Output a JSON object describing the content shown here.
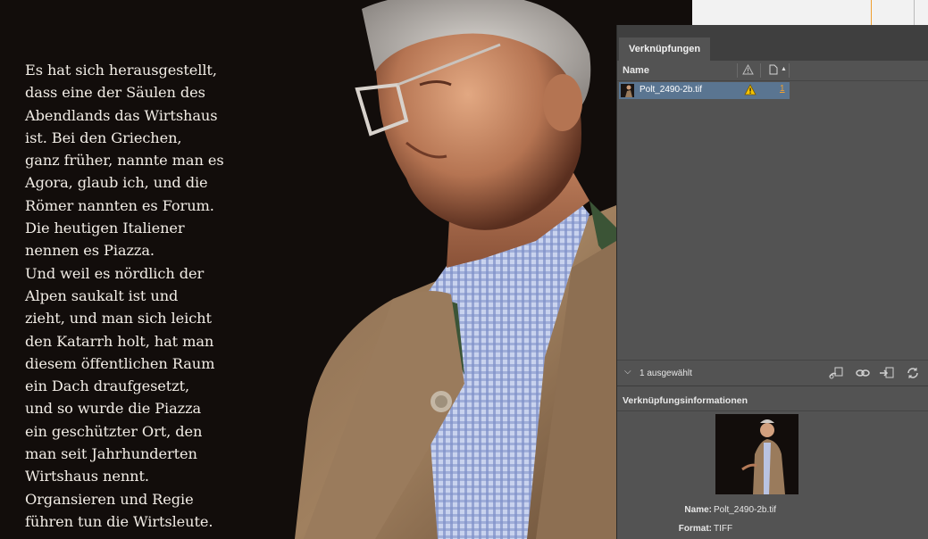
{
  "document": {
    "quote": "Es hat sich herausgestellt,\ndass eine der Säulen des\nAbendlands das Wirtshaus\nist. Bei den Griechen,\nganz früher, nannte man es\nAgora, glaub ich, und die\nRömer nannten es Forum.\nDie heutigen Italiener\nnennen es Piazza.\nUnd weil es nördlich der\nAlpen saukalt ist und\nzieht, und man sich leicht\nden Katarrh holt, hat man\ndiesem öffentlichen Raum\nein Dach draufgesetzt,\nund so wurde die Piazza\nein geschützter Ort, den\nman seit Jahrhunderten\nWirtshaus nennt.\nOrgansieren und Regie\nführen tun die Wirtsleute."
  },
  "links_panel": {
    "tab_label": "Verknüpfungen",
    "columns": {
      "name": "Name",
      "status_icon": "warning-icon",
      "page_icon": "page-icon"
    },
    "rows": [
      {
        "filename": "Polt_2490-2b.tif",
        "status": "warning",
        "page": "1"
      }
    ],
    "selection_status": "1 ausgewählt",
    "toolbar_icons": [
      "relink-from-cc-icon",
      "relink-icon",
      "go-to-link-icon",
      "update-link-icon"
    ],
    "info": {
      "title": "Verknüpfungsinformationen",
      "fields": [
        {
          "label": "Name:",
          "value": "Polt_2490-2b.tif"
        },
        {
          "label": "Format:",
          "value": "TIFF"
        }
      ]
    }
  },
  "colors": {
    "panel_bg": "#535353",
    "selection": "#5a7591",
    "warning": "#f5c400",
    "page_link": "#f0a030"
  }
}
